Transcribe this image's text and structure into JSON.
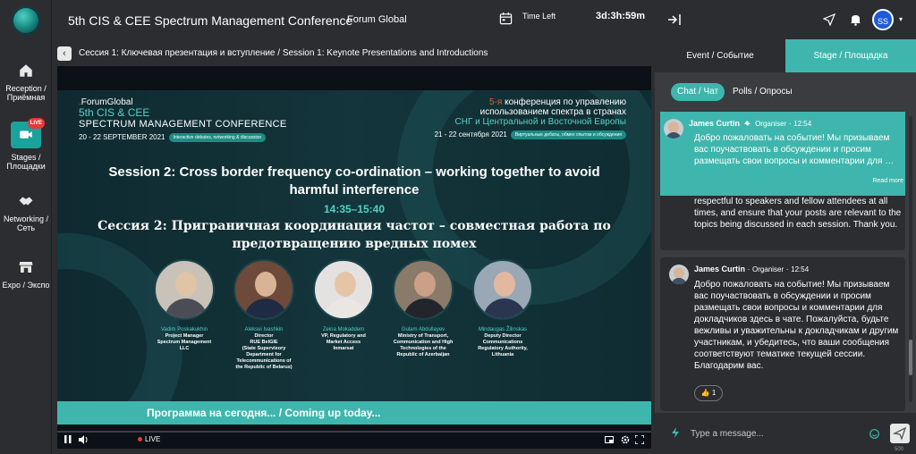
{
  "app": {
    "title": "5th CIS & CEE Spectrum Management Conference",
    "organizer": "Forum Global",
    "time_left_label": "Time Left",
    "time_left_value": "3d:3h:59m"
  },
  "leftnav": {
    "items": [
      {
        "label": "Reception / Приёмная",
        "icon": "home-icon"
      },
      {
        "label": "Stages / Площадки",
        "icon": "stage-icon",
        "badge": "LIVE"
      },
      {
        "label": "Networking / Сеть",
        "icon": "handshake-icon"
      },
      {
        "label": "Expo / Экспо",
        "icon": "store-icon"
      }
    ]
  },
  "breadcrumb": {
    "back": "‹",
    "text": "Сессия 1: Ключевая презентация и вступление / Session 1: Keynote Presentations and Introductions"
  },
  "slide": {
    "brand": "ForumGlobal",
    "conf_line1": "5th CIS & CEE",
    "conf_line2": "SPECTRUM MANAGEMENT CONFERENCE",
    "date_en": "20 - 22 SEPTEMBER 2021",
    "pill_en": "Interactive debates, networking & discussion",
    "ru_line1_accent": "5-я",
    "ru_line1": " конференция по управлению",
    "ru_line2": "использованием спектра в странах",
    "ru_line3": "СНГ и Центральной и Восточной Европы",
    "date_ru": "21 - 22 сентября 2021",
    "pill_ru": "Виртуальные дебаты, обмен опытом и обсуждения",
    "session_en_1": "Session 2: Cross border frequency co-ordination – working together to avoid",
    "session_en_2": "harmful interference",
    "session_time": "14:35–15:40",
    "session_ru_1": "Сессия 2: Приграничная координация частот – совместная работа по",
    "session_ru_2": "предотвращению вредных помех",
    "speakers": [
      {
        "name": "Vadim Poskakukhin",
        "title": [
          "Project Manager",
          "Spectrum Management",
          "LLC"
        ],
        "skin": "#e0c4a8",
        "suit": "#4a4d55",
        "bg": "#c9c2b8"
      },
      {
        "name": "Aleksei Ivashkin",
        "title": [
          "Director",
          "RUE BelGIE",
          "(State Supervisory",
          "Department for",
          "Telecommunications of",
          "the Republic of Belarus)"
        ],
        "skin": "#d8b396",
        "suit": "#1f2a44",
        "bg": "#6e4a3a"
      },
      {
        "name": "Zeina Mokaddem",
        "title": [
          "VP, Regulatory and",
          "Market Access",
          "Inmarsat"
        ],
        "skin": "#e6c4a6",
        "suit": "#e9e6e3",
        "bg": "#e4e2e1"
      },
      {
        "name": "Gulam Abdullayev",
        "title": [
          "Ministry of Transport,",
          "Communication and High",
          "Technologies of the",
          "Republic of Azerbaijan"
        ],
        "skin": "#caa088",
        "suit": "#22252c",
        "bg": "#8a7a6a"
      },
      {
        "name": "Mindaugas Žilinskas",
        "title": [
          "Deputy Director",
          "Communications",
          "Regulatory Authority,",
          "Lithuania"
        ],
        "skin": "#e2b8a0",
        "suit": "#2a3550",
        "bg": "#9aa8b5"
      }
    ]
  },
  "coming_up": "Программа на сегодня... / Coming up today...",
  "player": {
    "live_label": "LIVE"
  },
  "rightpanel": {
    "avatar_initials": "SS",
    "tabs": [
      "Event / Событие",
      "Stage / Площадка"
    ],
    "active_tab": 1,
    "subtabs": [
      "Chat / Чат",
      "Polls / Опросы"
    ],
    "messages": {
      "pinned": {
        "author": "James Curtin",
        "role": "Organiser",
        "time": "12:54",
        "text": "Добро пожаловать на событие! Мы призываем вас поучаствовать в обсуждении и просим размещать свои вопросы и комментарии для …",
        "read_more": "Read more"
      },
      "partial": {
        "text": "respectful to speakers and fellow attendees at all times, and ensure that your posts are relevant to the topics being discussed in each session. Thank you."
      },
      "full": {
        "author": "James Curtin",
        "role": "Organiser",
        "time": "12:54",
        "text": "Добро пожаловать на событие! Мы призываем вас поучаствовать в обсуждении и просим размещать свои вопросы и комментарии для докладчиков здесь в чате. Пожалуйста, будьте вежливы и уважительны к докладчикам и другим участникам, и убедитесь, что ваши сообщения соответствуют тематике текущей сессии. Благодарим вас.",
        "reaction_count": "1"
      }
    },
    "composer": {
      "placeholder": "Type a message...",
      "counter": "500"
    }
  },
  "colors": {
    "accent": "#3fb6ad",
    "panel": "#2b2d31",
    "chat_bg": "#3a3c40",
    "live": "#e53935"
  }
}
